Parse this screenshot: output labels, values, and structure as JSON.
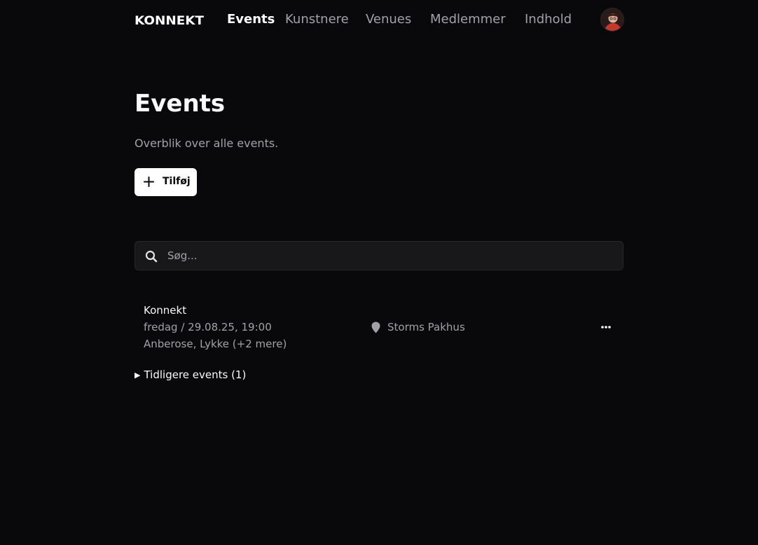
{
  "nav": {
    "logo": "KONNEKT",
    "links": [
      {
        "label": "Events",
        "active": true
      },
      {
        "label": "Kunstnere",
        "active": false
      },
      {
        "label": "Venues",
        "active": false
      },
      {
        "label": "Medlemmer",
        "active": false
      },
      {
        "label": "Indhold",
        "active": false
      }
    ]
  },
  "page": {
    "title": "Events",
    "subtitle": "Overblik over alle events.",
    "add_label": "Tilføj"
  },
  "search": {
    "placeholder": "Søg...",
    "value": ""
  },
  "events": [
    {
      "name": "Konnekt",
      "date": "fredag / 29.08.25, 19:00",
      "artists": "Anberose, Lykke (+2 mere)",
      "venue": "Storms Pakhus"
    }
  ],
  "past": {
    "label": "Tidligere events (1)"
  },
  "colors": {
    "background": "#09090b",
    "text": "#fafafa",
    "muted": "#a1a1aa",
    "input_bg": "#18181b",
    "button_bg": "#ffffff",
    "avatar_accent": "#c0392b"
  },
  "icons": [
    "plus-icon",
    "search-icon",
    "map-pin-icon",
    "more-horizontal-icon",
    "disclosure-triangle-icon"
  ]
}
